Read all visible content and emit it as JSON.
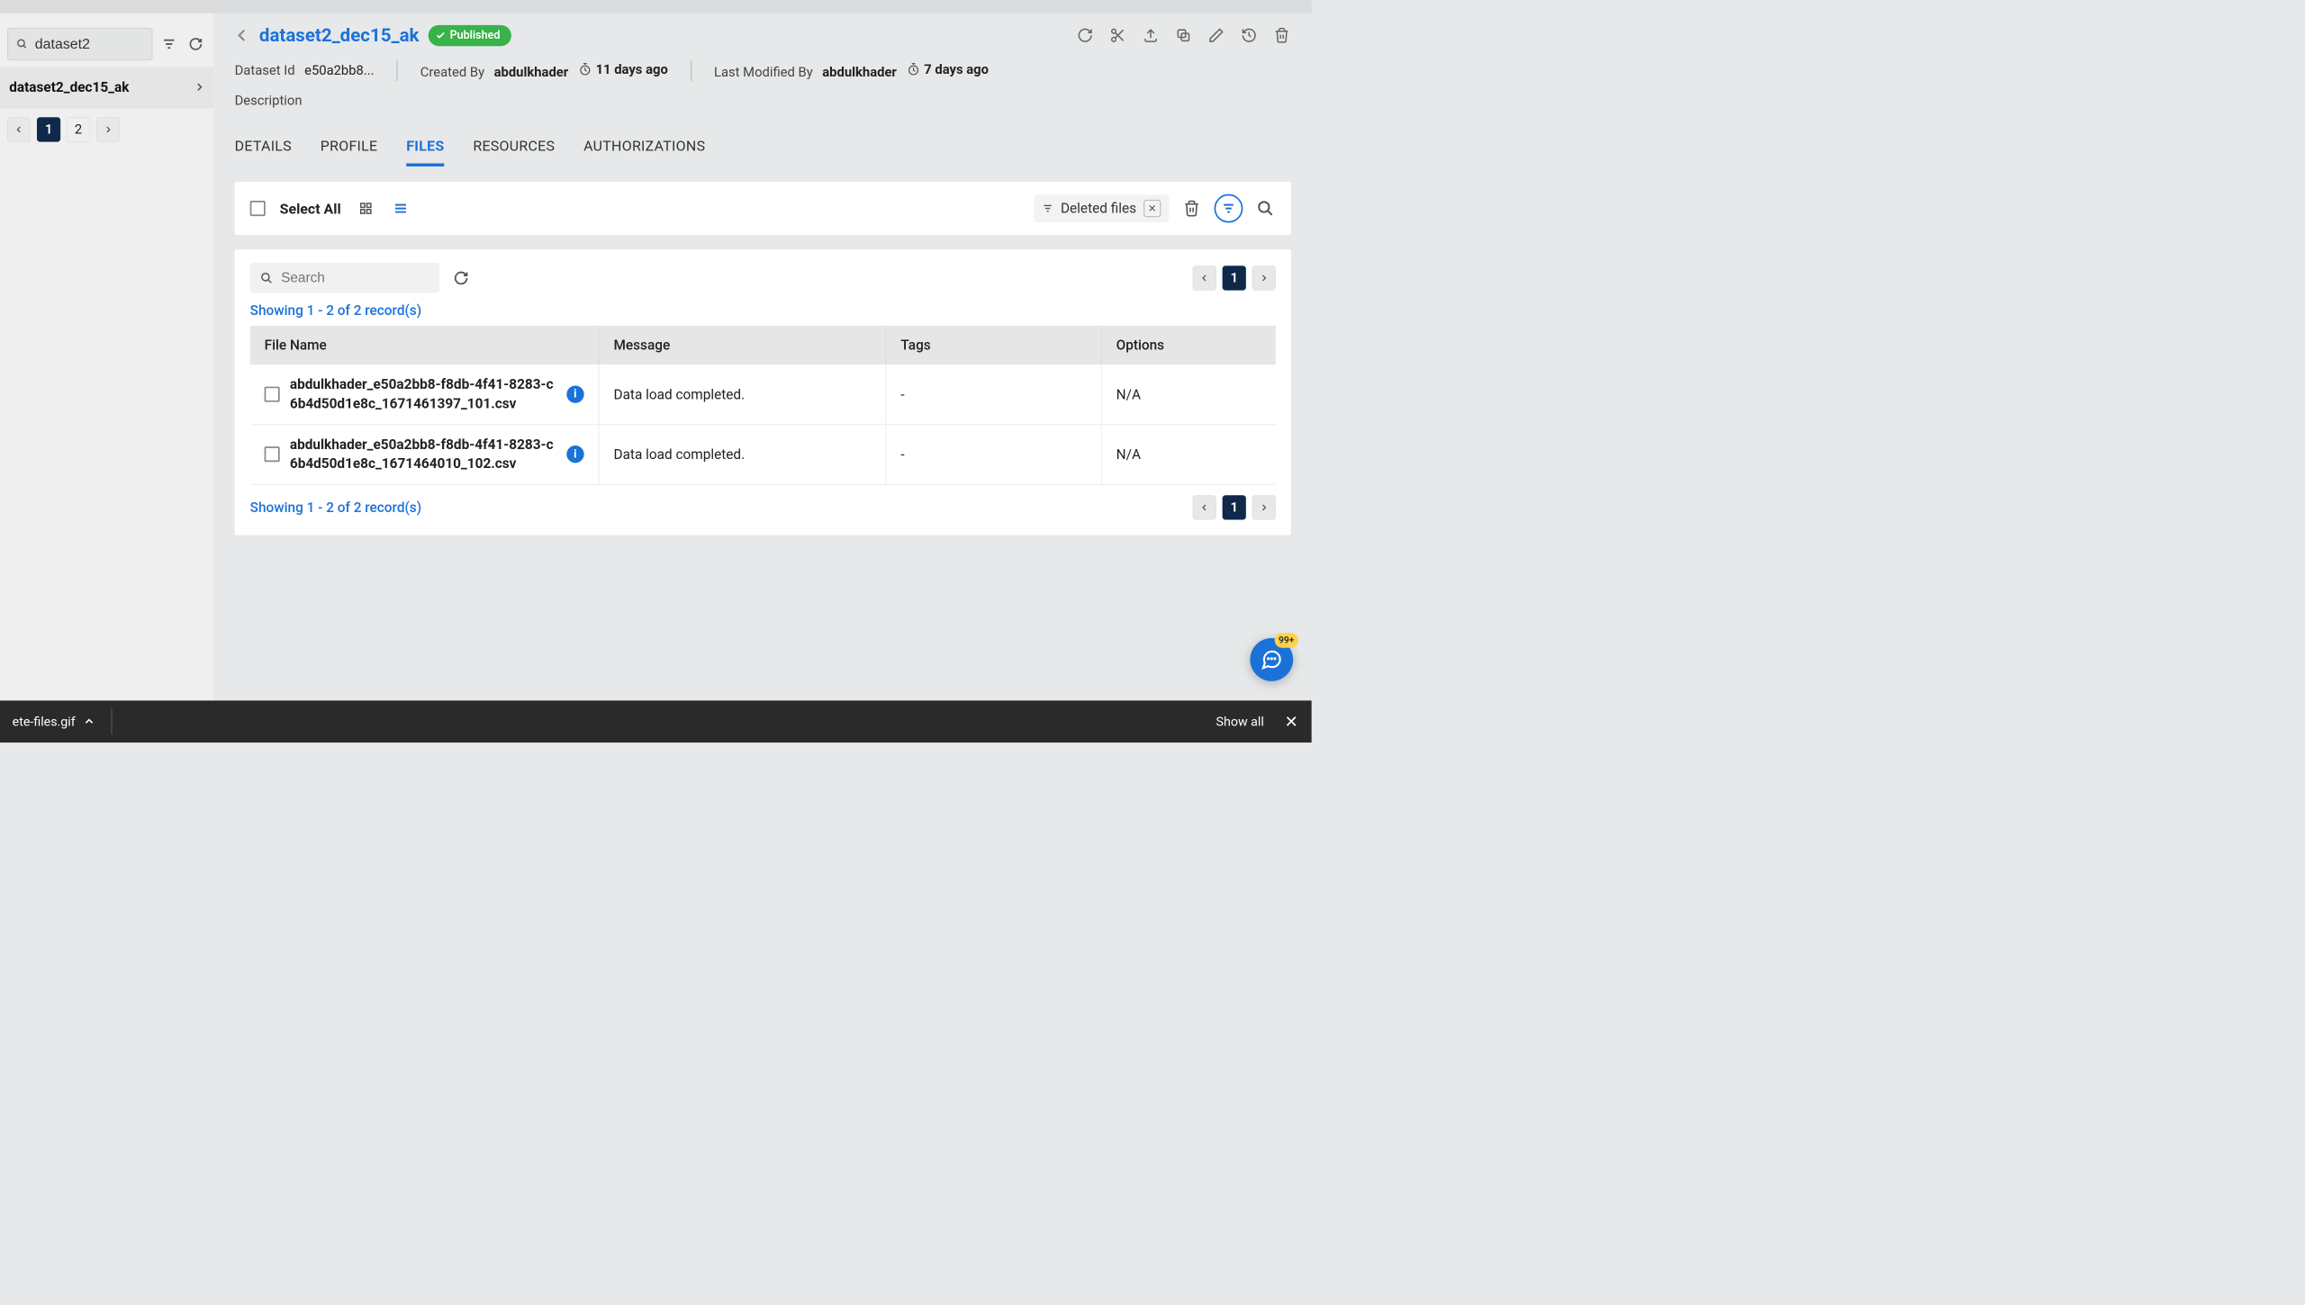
{
  "sidebar": {
    "search_value": "dataset2",
    "item_label": "dataset2_dec15_ak",
    "pages": [
      "1",
      "2"
    ],
    "active_page": "1"
  },
  "header": {
    "title": "dataset2_dec15_ak",
    "badge": "Published",
    "dataset_id_label": "Dataset Id",
    "dataset_id": "e50a2bb8...",
    "created_by_label": "Created By",
    "created_by": "abdulkhader",
    "created_ago": "11 days ago",
    "modified_by_label": "Last Modified By",
    "modified_by": "abdulkhader",
    "modified_ago": "7 days ago",
    "description_label": "Description"
  },
  "tabs": {
    "details": "DETAILS",
    "profile": "PROFILE",
    "files": "FILES",
    "resources": "RESOURCES",
    "authorizations": "AUTHORIZATIONS"
  },
  "toolbar": {
    "select_all": "Select All",
    "filter_chip": "Deleted files"
  },
  "files": {
    "search_placeholder": "Search",
    "records_text": "Showing 1 - 2 of 2 record(s)",
    "columns": {
      "name": "File Name",
      "message": "Message",
      "tags": "Tags",
      "options": "Options"
    },
    "rows": [
      {
        "name": "abdulkhader_e50a2bb8-f8db-4f41-8283-c6b4d50d1e8c_1671461397_101.csv",
        "message": "Data load completed.",
        "tags": "-",
        "options": "N/A"
      },
      {
        "name": "abdulkhader_e50a2bb8-f8db-4f41-8283-c6b4d50d1e8c_1671464010_102.csv",
        "message": "Data load completed.",
        "tags": "-",
        "options": "N/A"
      }
    ],
    "active_page": "1"
  },
  "help_badge": "99+",
  "download_bar": {
    "filename": "ete-files.gif",
    "show_all": "Show all"
  }
}
